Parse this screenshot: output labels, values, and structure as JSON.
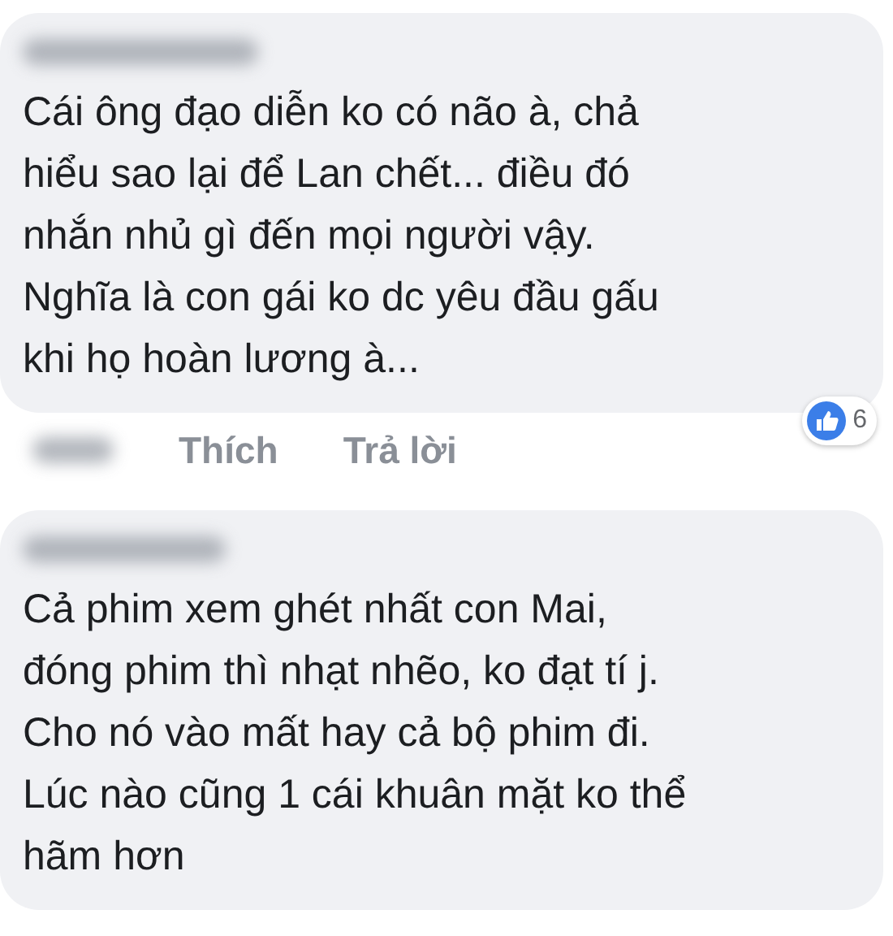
{
  "comments": [
    {
      "text": "Cái ông đạo diễn ko có não à, chả\nhiểu sao lại để Lan chết... điều đó\nnhắn nhủ gì đến mọi người vậy.\nNghĩa là con gái ko dc yêu đầu gấu\nkhi họ hoàn lương à...",
      "actions": [
        "Thích",
        "Trả lời"
      ],
      "likes": "6"
    },
    {
      "text": "Cả phim xem ghét nhất con Mai,\nđóng phim thì nhạt nhẽo, ko đạt tí j.\nCho nó vào mất hay cả bộ phim đi.\nLúc nào cũng 1 cái khuân mặt ko thể\nhãm hơn"
    }
  ]
}
